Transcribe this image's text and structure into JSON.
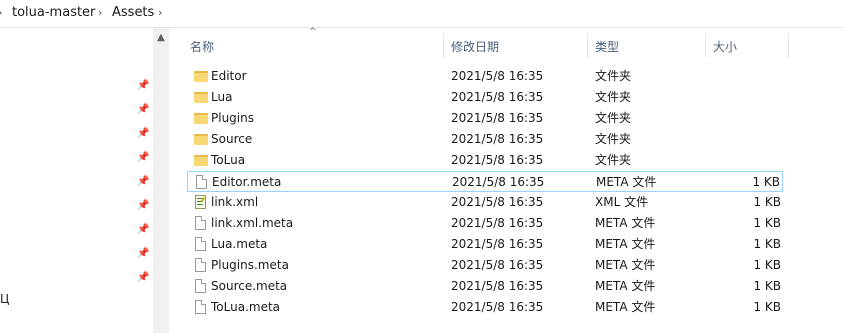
{
  "breadcrumb": {
    "items": [
      "tolua-master",
      "Assets"
    ]
  },
  "nav": {
    "partial_label": "Ц",
    "pin_count": 8
  },
  "columns": {
    "name": "名称",
    "date": "修改日期",
    "type": "类型",
    "size": "大小"
  },
  "files": [
    {
      "name": "Editor",
      "date": "2021/5/8 16:35",
      "type": "文件夹",
      "size": "",
      "icon": "folder-icon"
    },
    {
      "name": "Lua",
      "date": "2021/5/8 16:35",
      "type": "文件夹",
      "size": "",
      "icon": "folder-icon"
    },
    {
      "name": "Plugins",
      "date": "2021/5/8 16:35",
      "type": "文件夹",
      "size": "",
      "icon": "folder-icon"
    },
    {
      "name": "Source",
      "date": "2021/5/8 16:35",
      "type": "文件夹",
      "size": "",
      "icon": "folder-icon"
    },
    {
      "name": "ToLua",
      "date": "2021/5/8 16:35",
      "type": "文件夹",
      "size": "",
      "icon": "folder-icon"
    },
    {
      "name": "Editor.meta",
      "date": "2021/5/8 16:35",
      "type": "META 文件",
      "size": "1 KB",
      "icon": "file-icon",
      "selected": true
    },
    {
      "name": "link.xml",
      "date": "2021/5/8 16:35",
      "type": "XML 文件",
      "size": "1 KB",
      "icon": "xml-file-icon"
    },
    {
      "name": "link.xml.meta",
      "date": "2021/5/8 16:35",
      "type": "META 文件",
      "size": "1 KB",
      "icon": "file-icon"
    },
    {
      "name": "Lua.meta",
      "date": "2021/5/8 16:35",
      "type": "META 文件",
      "size": "1 KB",
      "icon": "file-icon"
    },
    {
      "name": "Plugins.meta",
      "date": "2021/5/8 16:35",
      "type": "META 文件",
      "size": "1 KB",
      "icon": "file-icon"
    },
    {
      "name": "Source.meta",
      "date": "2021/5/8 16:35",
      "type": "META 文件",
      "size": "1 KB",
      "icon": "file-icon"
    },
    {
      "name": "ToLua.meta",
      "date": "2021/5/8 16:35",
      "type": "META 文件",
      "size": "1 KB",
      "icon": "file-icon"
    }
  ]
}
